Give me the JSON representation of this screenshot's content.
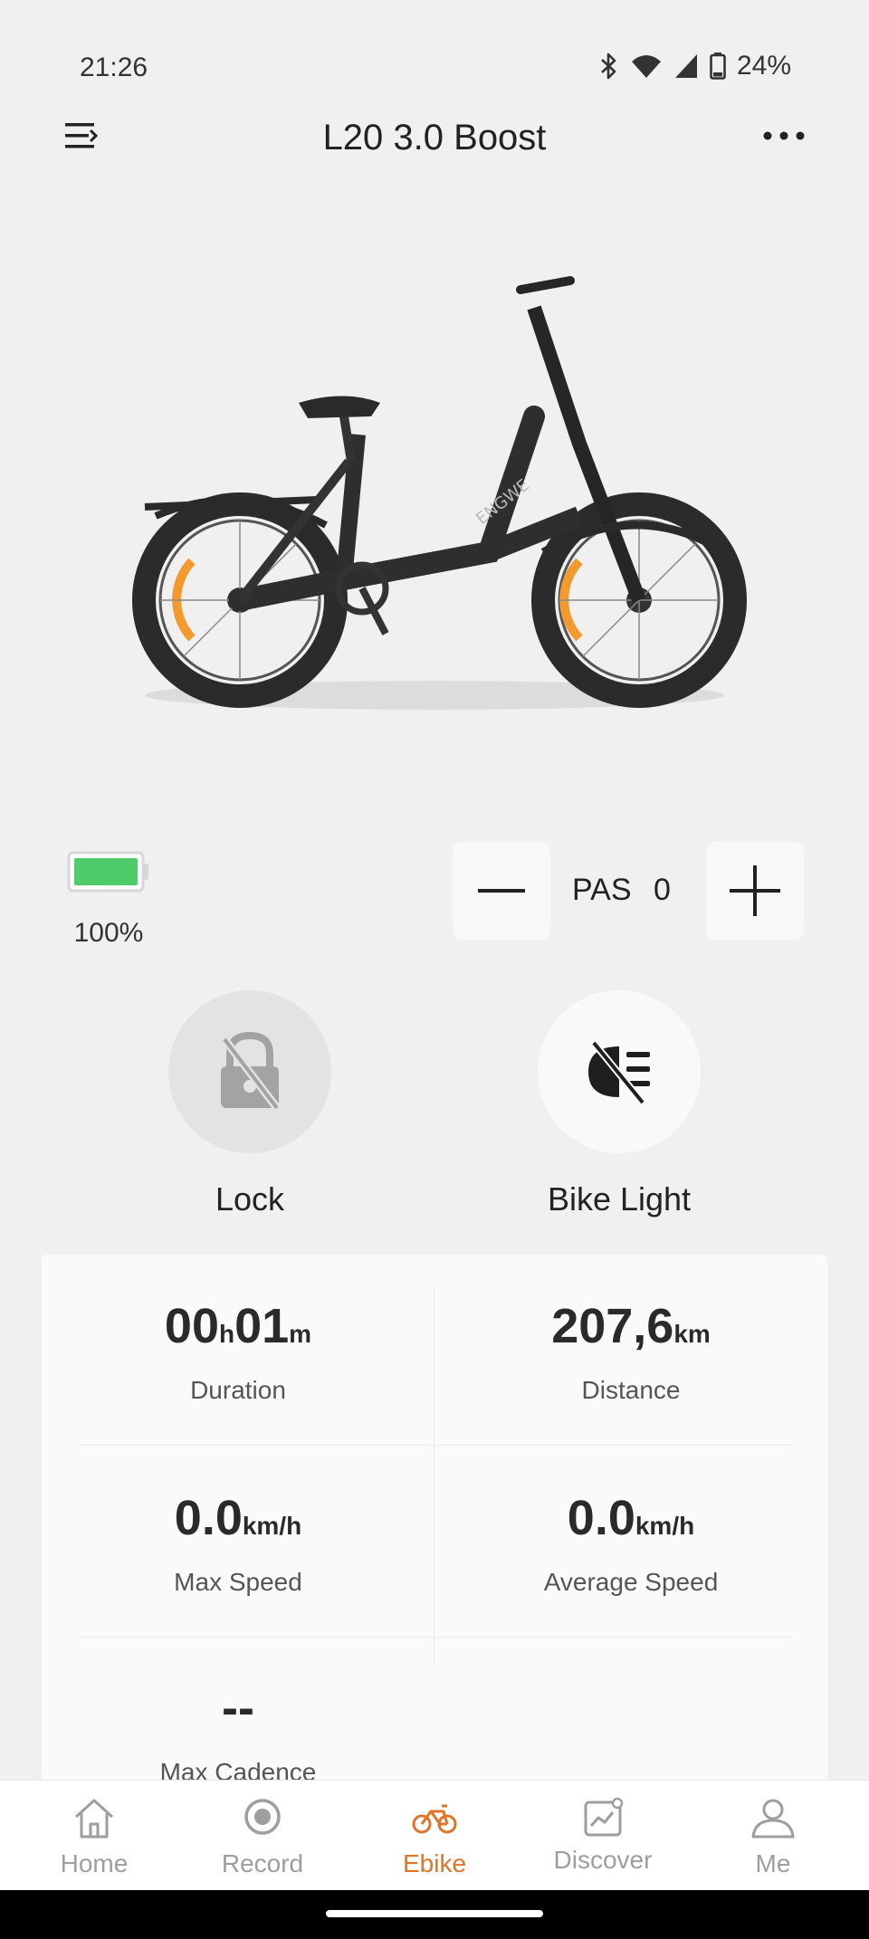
{
  "status_bar": {
    "time": "21:26",
    "battery_percent": "24%",
    "icons": [
      "bluetooth-icon",
      "wifi-icon",
      "signal-icon",
      "battery-icon"
    ]
  },
  "header": {
    "title": "L20 3.0 Boost",
    "menu_icon": "menu-icon",
    "more_icon": "more-icon"
  },
  "bike": {
    "brand_mark": "ENGWE"
  },
  "battery": {
    "level_fraction": 1.0,
    "label": "100%",
    "fill_color": "#4fcc6a"
  },
  "pas": {
    "label": "PAS",
    "value": "0",
    "minus_icon": "minus-icon",
    "plus_icon": "plus-icon"
  },
  "controls": {
    "lock_label": "Lock",
    "lock_icon": "lock-off-icon",
    "light_label": "Bike Light",
    "light_icon": "headlight-off-icon"
  },
  "stats": {
    "duration": {
      "hours": "00",
      "h_unit": "h",
      "minutes": "01",
      "m_unit": "m",
      "label": "Duration"
    },
    "distance": {
      "value": "207,6",
      "unit": "km",
      "label": "Distance"
    },
    "max_speed": {
      "value": "0.0",
      "unit": "km/h",
      "label": "Max Speed"
    },
    "avg_speed": {
      "value": "0.0",
      "unit": "km/h",
      "label": "Average Speed"
    },
    "max_cadence": {
      "value": "--",
      "label": "Max Cadence"
    }
  },
  "nav": {
    "items": [
      {
        "label": "Home",
        "icon": "home-icon"
      },
      {
        "label": "Record",
        "icon": "record-icon"
      },
      {
        "label": "Ebike",
        "icon": "bike-icon",
        "active": true
      },
      {
        "label": "Discover",
        "icon": "discover-icon"
      },
      {
        "label": "Me",
        "icon": "user-icon"
      }
    ],
    "active_color": "#e0752a",
    "inactive_color": "#9e9e9e"
  }
}
